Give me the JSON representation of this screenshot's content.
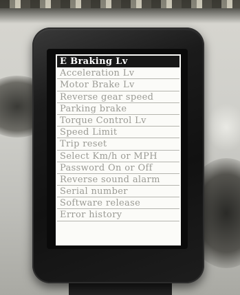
{
  "menu": {
    "items": [
      {
        "label": "E Braking Lv",
        "selected": true
      },
      {
        "label": "Acceleration Lv",
        "selected": false
      },
      {
        "label": "Motor Brake Lv",
        "selected": false
      },
      {
        "label": "Reverse gear speed",
        "selected": false
      },
      {
        "label": "Parking brake",
        "selected": false
      },
      {
        "label": "Torque Control Lv",
        "selected": false
      },
      {
        "label": "Speed Limit",
        "selected": false
      },
      {
        "label": "Trip reset",
        "selected": false
      },
      {
        "label": "Select Km/h or MPH",
        "selected": false
      },
      {
        "label": "Password On or Off",
        "selected": false
      },
      {
        "label": "Reverse sound alarm",
        "selected": false
      },
      {
        "label": "Serial number",
        "selected": false
      },
      {
        "label": "Software release",
        "selected": false
      },
      {
        "label": "Error history",
        "selected": false
      }
    ]
  },
  "colors": {
    "screen_background": "#fbfbf8",
    "selected_background": "#171717",
    "selected_text": "#ffffff",
    "item_text": "#9a9a94",
    "device_body": "#111111"
  }
}
